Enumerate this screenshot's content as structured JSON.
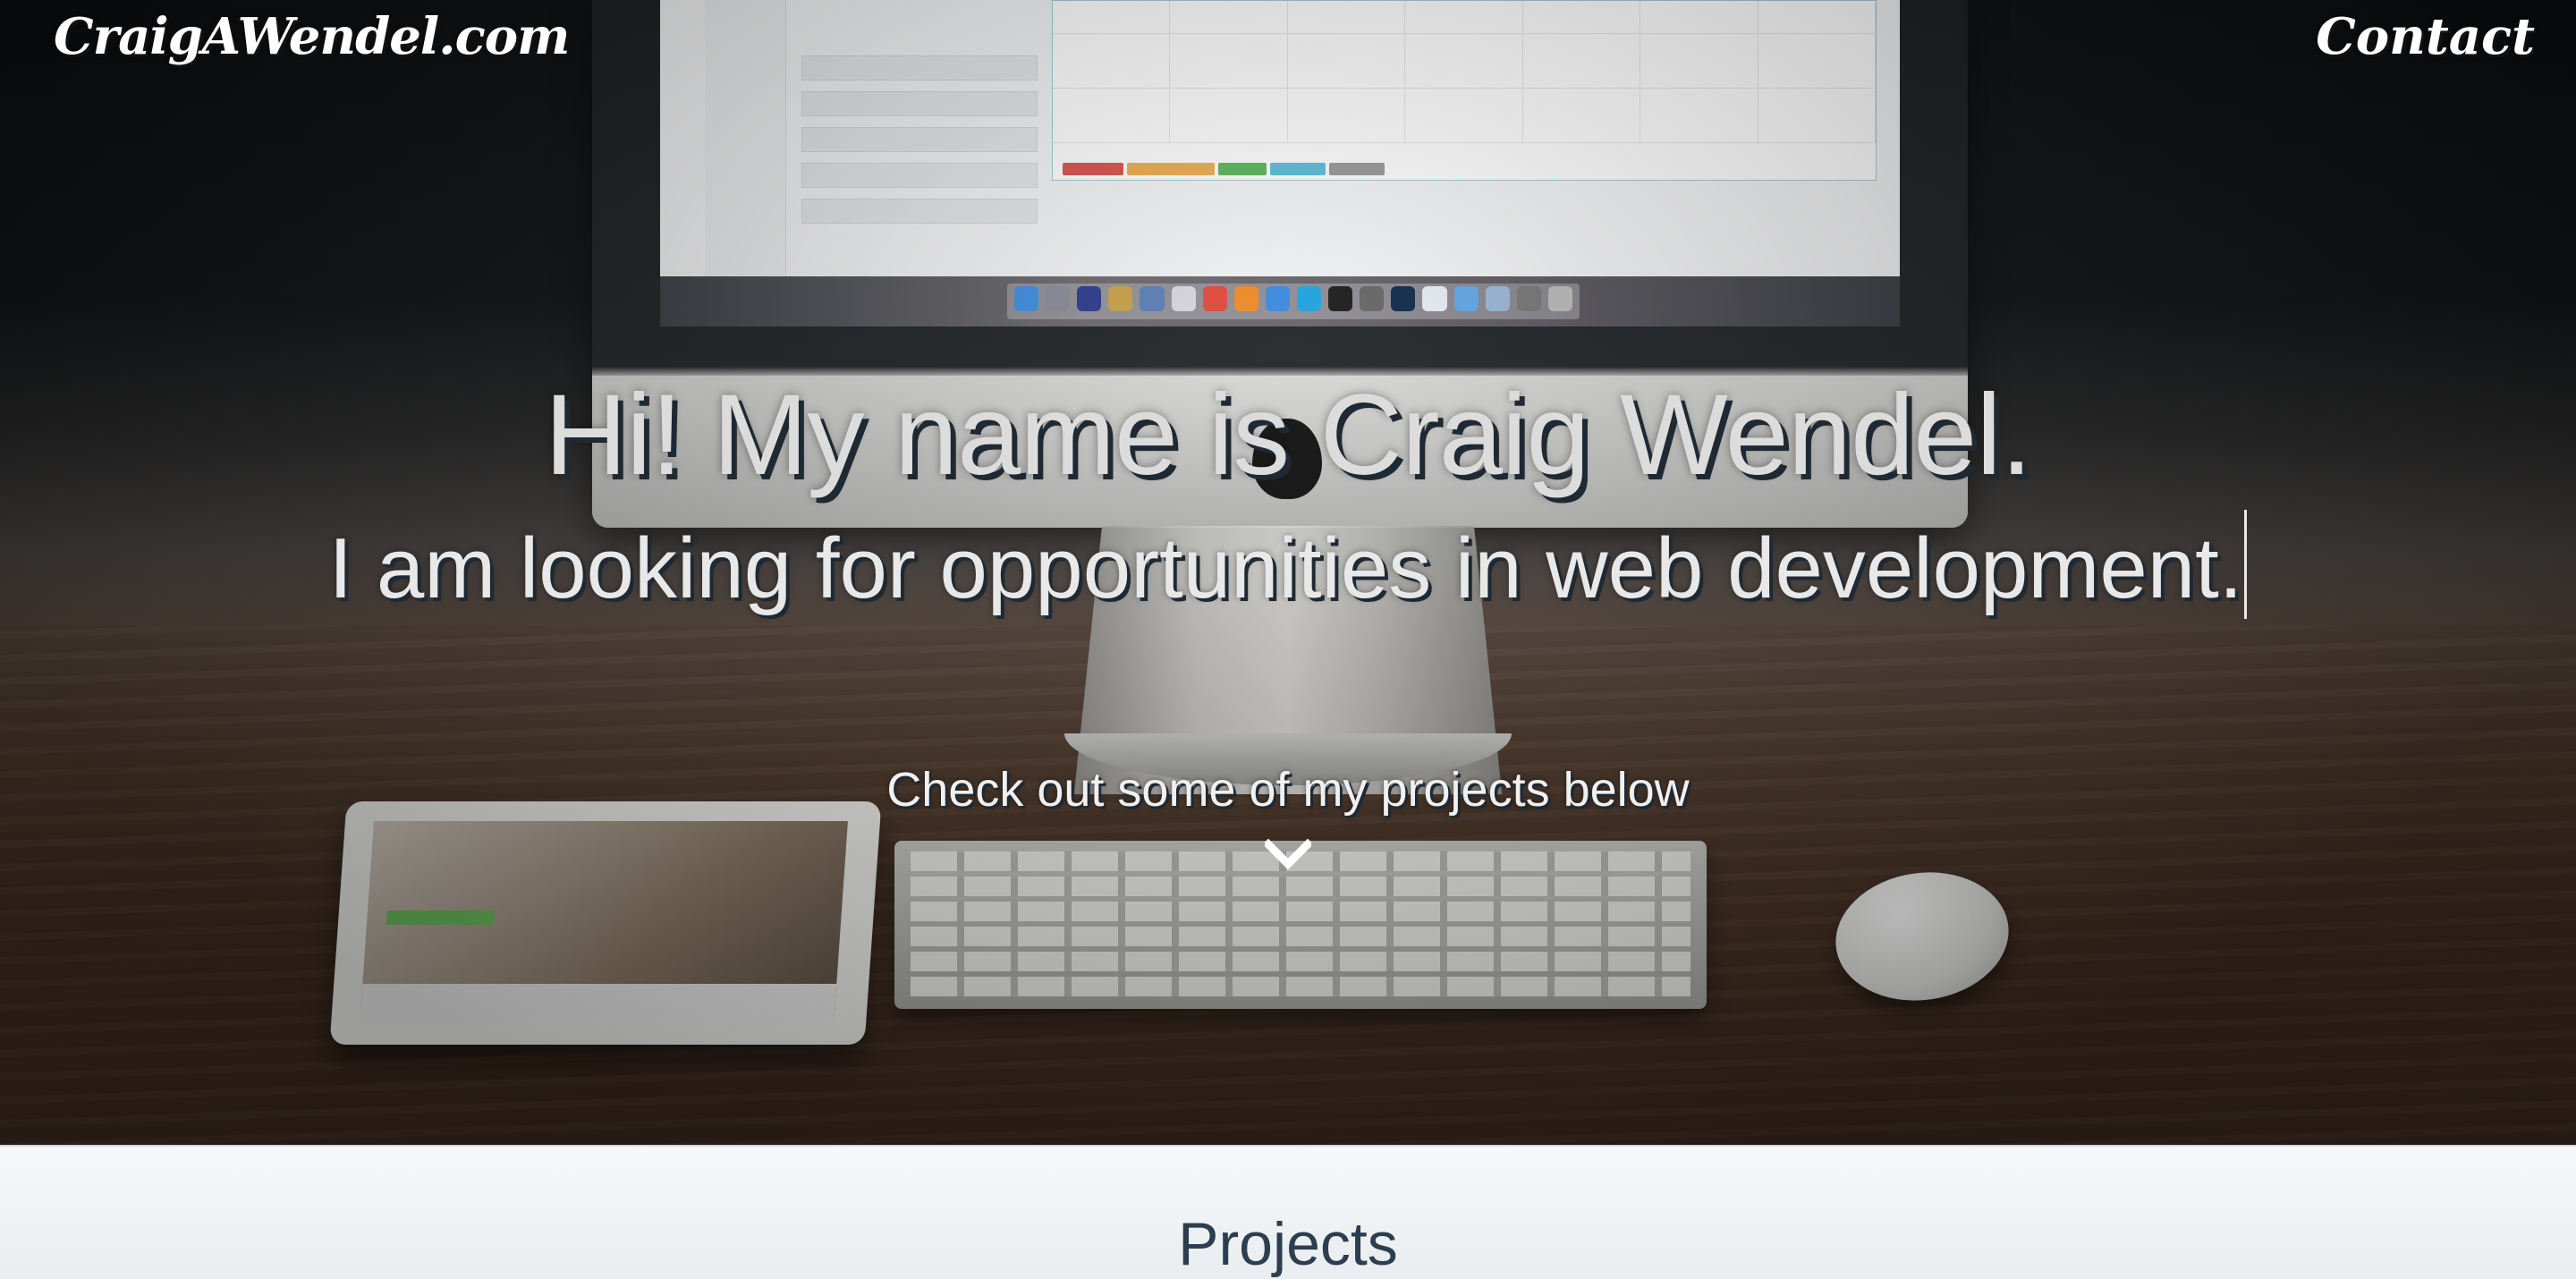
{
  "nav": {
    "brand": "CraigAWendel.com",
    "contact": "Contact"
  },
  "hero": {
    "headline": "Hi! My name is Craig Wendel.",
    "subline": "I am looking for opportunities in web development.",
    "cta": "Check out some of my projects below",
    "scroll_icon": "chevron-down-icon"
  },
  "projects": {
    "heading": "Projects"
  },
  "colors": {
    "heading_dark": "#2c3e50",
    "text_shadow": "#1f2933",
    "section_bg": "#eef1f3"
  }
}
